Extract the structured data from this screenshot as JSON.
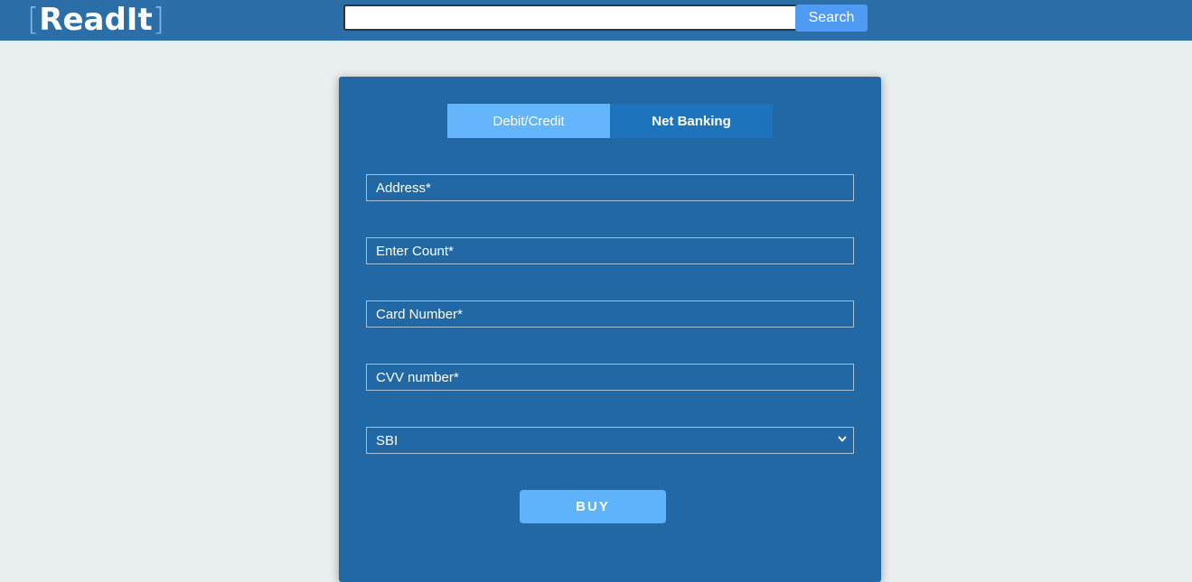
{
  "header": {
    "logo_left_bracket": "[",
    "logo_text": "ReadIt",
    "logo_right_bracket": "]",
    "search_placeholder": "",
    "search_value": "",
    "search_button_label": "Search"
  },
  "payment": {
    "tabs": [
      {
        "label": "Debit/Credit",
        "active": true
      },
      {
        "label": "Net Banking",
        "active": false
      }
    ],
    "fields": {
      "address_placeholder": "Address*",
      "count_placeholder": "Enter Count*",
      "card_number_placeholder": "Card Number*",
      "cvv_placeholder": "CVV number*"
    },
    "bank_select": {
      "selected": "SBI",
      "options": [
        "SBI"
      ]
    },
    "buy_label": "BUY"
  },
  "colors": {
    "header_bg": "#2c6ea8",
    "page_bg": "#e9eeef",
    "card_bg": "#2268a4",
    "active_tab": "#64b5fb",
    "inactive_tab": "#1d74bd",
    "search_button": "#4f9bf4",
    "buy_button": "#5eb3fb",
    "logo_bracket": "#7fb6ee"
  },
  "icons": {
    "select_arrow": "chevron-down-icon"
  }
}
